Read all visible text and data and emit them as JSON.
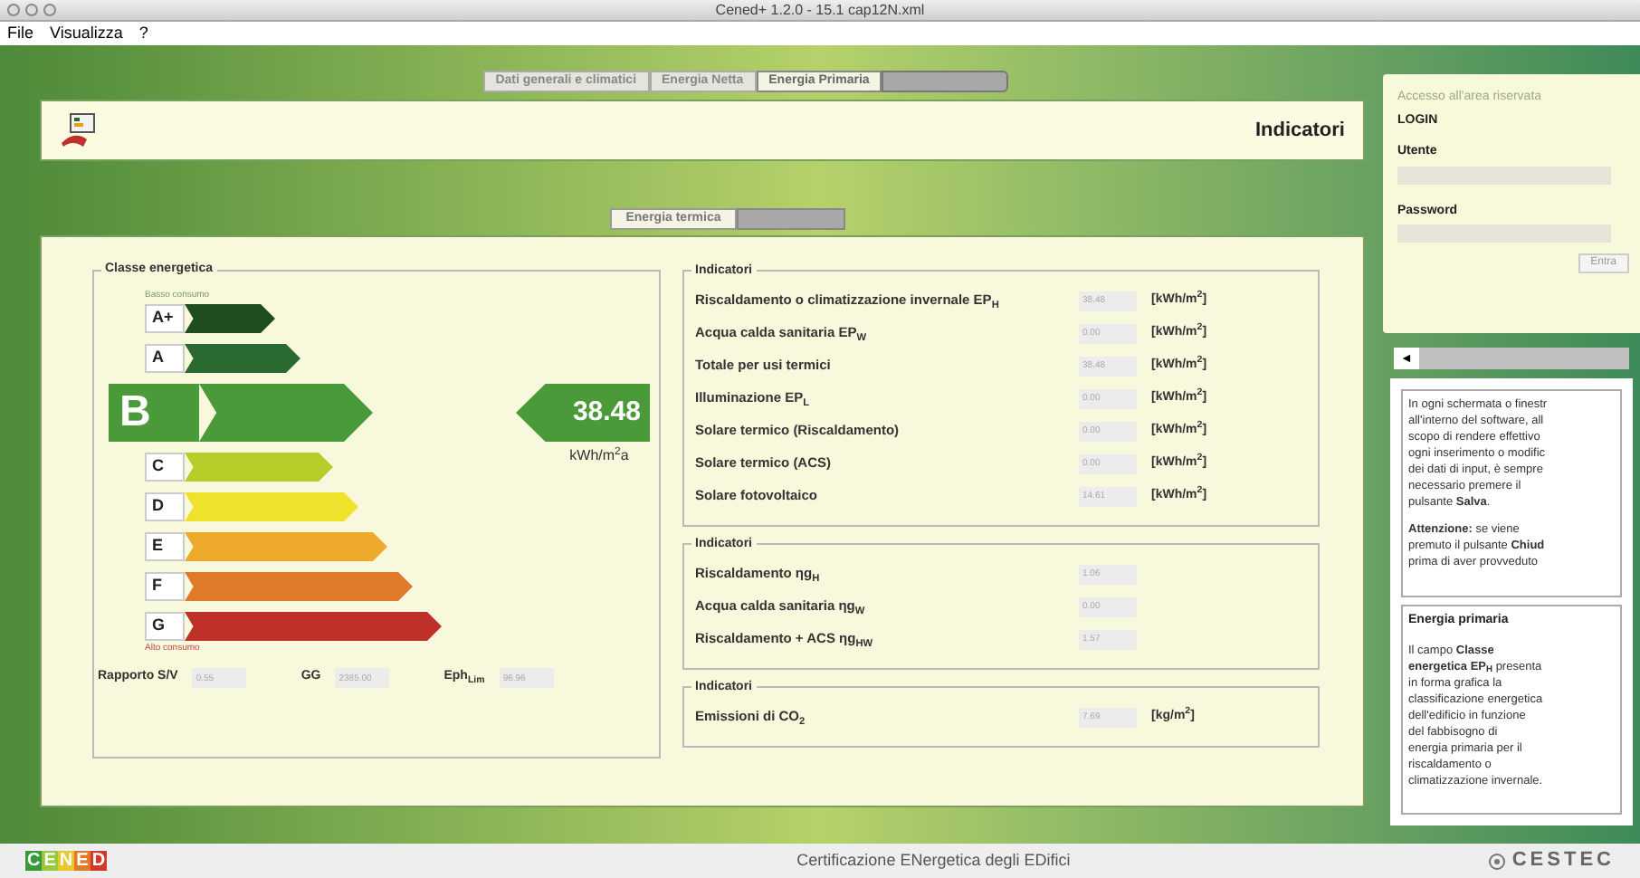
{
  "window": {
    "title": "Cened+ 1.2.0 - 15.1 cap12N.xml"
  },
  "menu": [
    "File",
    "Visualizza",
    "?"
  ],
  "tabs": [
    {
      "label": "Dati generali e climatici",
      "selected": false
    },
    {
      "label": "Energia Netta",
      "selected": false
    },
    {
      "label": "Energia Primaria",
      "selected": true
    }
  ],
  "header": {
    "title": "Indicatori"
  },
  "subtabs": [
    {
      "label": "Energia termica",
      "selected": true
    }
  ],
  "classe": {
    "title": "Classe energetica",
    "top_label": "Basso consumo",
    "bottom_label": "Alto consumo",
    "classes": [
      {
        "label": "A+",
        "color": "#1f4d22",
        "selected": false
      },
      {
        "label": "A",
        "color": "#2a6a30",
        "selected": false
      },
      {
        "label": "B",
        "color": "#4a9a3a",
        "selected": true
      },
      {
        "label": "C",
        "color": "#b8cc2a",
        "selected": false
      },
      {
        "label": "D",
        "color": "#f0e22a",
        "selected": false
      },
      {
        "label": "E",
        "color": "#eeaa2a",
        "selected": false
      },
      {
        "label": "F",
        "color": "#e07a2a",
        "selected": false
      },
      {
        "label": "G",
        "color": "#c0302a",
        "selected": false
      }
    ],
    "value": "38.48",
    "unit": "kWh/m$^{2}$a",
    "fields": [
      {
        "label": "Rapporto S/V",
        "value": "0.55"
      },
      {
        "label": "GG",
        "value": "2385.00"
      },
      {
        "label": "Eph$_{Lim}$",
        "value": "96.96"
      }
    ]
  },
  "groups": [
    {
      "title": "Indicatori",
      "rows": [
        {
          "label": "Riscaldamento o climatizzazione invernale EP$_{H}$",
          "value": "38.48",
          "unit": "[kWh/m$^{2}$]"
        },
        {
          "label": "Acqua calda sanitaria EP$_{W}$",
          "value": "0.00",
          "unit": "[kWh/m$^{2}$]"
        },
        {
          "label": "Totale per usi termici",
          "value": "38.48",
          "unit": "[kWh/m$^{2}$]"
        },
        {
          "label": "Illuminazione EP$_{L}$",
          "value": "0.00",
          "unit": "[kWh/m$^{2}$]"
        },
        {
          "label": "Solare termico (Riscaldamento)",
          "value": "0.00",
          "unit": "[kWh/m$^{2}$]"
        },
        {
          "label": "Solare termico (ACS)",
          "value": "0.00",
          "unit": "[kWh/m$^{2}$]"
        },
        {
          "label": "Solare fotovoltaico",
          "value": "14.61",
          "unit": "[kWh/m$^{2}$]"
        }
      ]
    },
    {
      "title": "Indicatori",
      "rows": [
        {
          "label": "Riscaldamento ηg$_{H}$",
          "value": "1.06"
        },
        {
          "label": "Acqua calda sanitaria ηg$_{W}$",
          "value": "0.00"
        },
        {
          "label": "Riscaldamento + ACS ηg$_{HW}$",
          "value": "1.57"
        }
      ]
    },
    {
      "title": "Indicatori",
      "rows": [
        {
          "label": "Emissioni di CO$_{2}$",
          "value": "7.69",
          "unit": "[kg/m$^{2}$]"
        }
      ]
    }
  ],
  "login": {
    "caption": "Accesso all'area riservata",
    "title": "LOGIN",
    "user_label": "Utente",
    "password_label": "Password",
    "button": "Entra"
  },
  "collapse": {
    "arrow": "◄"
  },
  "help": [
    {
      "lines": [
        "In ogni schermata o finestr",
        "all'interno del software, all",
        "scopo di rendere effettivo",
        "ogni inserimento o modific",
        "dei dati di input, è sempre",
        "necessario premere il",
        "pulsante **Salva**."
      ]
    },
    {
      "lines": [
        "**Attenzione:** se viene",
        "premuto il pulsante **Chiud**",
        "prima di aver provveduto"
      ]
    },
    {
      "title": "Energia primaria",
      "lines": [
        "Il campo **Classe**",
        "**energetica EP$_{H}$** presenta",
        "in forma grafica la",
        "classificazione energetica",
        "dell'edificio in funzione",
        "del fabbisogno di",
        "energia primaria per il",
        "riscaldamento o",
        "climatizzazione invernale."
      ]
    }
  ],
  "footer": {
    "logo": "CENED",
    "text": "Certificazione ENergetica degli EDifici",
    "right_logo": "CESTEC"
  }
}
